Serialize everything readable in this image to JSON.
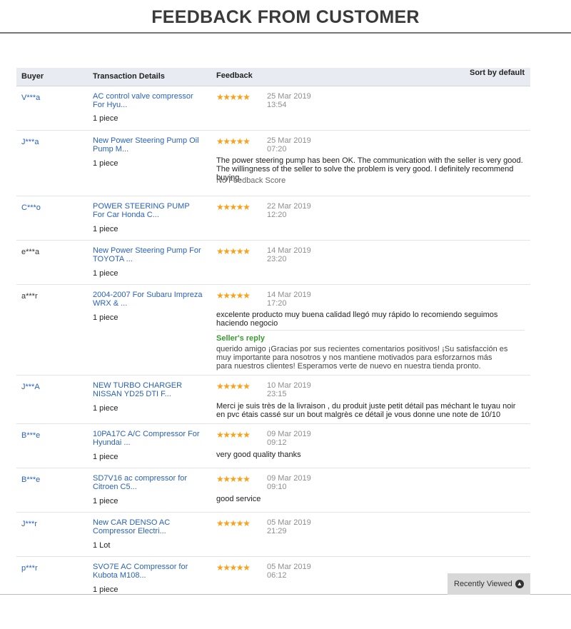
{
  "page": {
    "title": "FEEDBACK FROM CUSTOMER"
  },
  "table": {
    "headers": {
      "buyer": "Buyer",
      "transaction": "Transaction Details",
      "feedback": "Feedback",
      "sort": "Sort by default"
    },
    "rows": [
      {
        "buyer": "V***a",
        "product": "AC control valve compressor For Hyu...",
        "quantity": "1 piece",
        "stars": 5,
        "date": "25 Mar 2019",
        "time": "13:54"
      },
      {
        "buyer": "J***a",
        "product": "New Power Steering Pump Oil Pump M...",
        "quantity": "1 piece",
        "stars": 5,
        "date": "25 Mar 2019",
        "time": "07:20",
        "comment": "The power steering pump has been OK. The communication with the seller is very good. The willingness of the seller to solve the problem is very good. I definitely recommend buying.",
        "note": "No Feedback Score"
      },
      {
        "buyer": "C***o",
        "product": "POWER STEERING PUMP For Car Honda C...",
        "quantity": "1 piece",
        "stars": 5,
        "date": "22 Mar 2019",
        "time": "12:20"
      },
      {
        "buyer": "e***a",
        "product": "New Power Steering Pump For TOYOTA ...",
        "quantity": "1 piece",
        "stars": 5,
        "date": "14 Mar 2019",
        "time": "23:20"
      },
      {
        "buyer": "a***r",
        "product": "2004-2007 For Subaru Impreza WRX & ...",
        "quantity": "1 piece",
        "stars": 5,
        "date": "14 Mar 2019",
        "time": "17:20",
        "comment": "excelente producto muy buena calidad llegó muy rápido lo recomiendo seguimos haciendo negocio",
        "reply_label": "Seller's reply",
        "reply": "querido amigo ¡Gracias por sus recientes comentarios positivos! ¡Su satisfacción es muy importante para nosotros y nos mantiene motivados para esforzarnos más para nuestros clientes! Esperamos verte de nuevo en nuestra tienda pronto."
      },
      {
        "buyer": "J***A",
        "product": "NEW TURBO CHARGER NISSAN YD25 DTI F...",
        "quantity": "1 piece",
        "stars": 5,
        "date": "10 Mar 2019",
        "time": "23:15",
        "comment": "Merci je suis très de la livraison , du produit juste petit détail pas méchant le tuyau noir en pvc étais cassé sur un bout malgrès ce détail je vous donne une note de 10/10"
      },
      {
        "buyer": "B***e",
        "product": "10PA17C A/C Compressor For Hyundai ...",
        "quantity": "1 piece",
        "stars": 5,
        "date": "09 Mar 2019",
        "time": "09:12",
        "comment": "very good quality thanks"
      },
      {
        "buyer": "B***e",
        "product": "SD7V16 ac compressor for Citroen C5...",
        "quantity": "1 piece",
        "stars": 5,
        "date": "09 Mar 2019",
        "time": "09:10",
        "comment": "good service"
      },
      {
        "buyer": "J***r",
        "product": "New CAR DENSO AC Compressor Electri...",
        "quantity": "1 Lot",
        "stars": 5,
        "date": "05 Mar 2019",
        "time": "21:29"
      },
      {
        "buyer": "p***r",
        "product": "SVO7E AC Compressor for Kubota M108...",
        "quantity": "1 piece",
        "stars": 5,
        "date": "05 Mar 2019",
        "time": "06:12"
      }
    ]
  },
  "recently_viewed": {
    "label": "Recently Viewed",
    "icon": "chevron-up-icon"
  },
  "colors": {
    "link": "#2a62b9",
    "star": "#f7a21c",
    "reply": "#3a9a2f",
    "header_bg": "#e8ebf1"
  }
}
